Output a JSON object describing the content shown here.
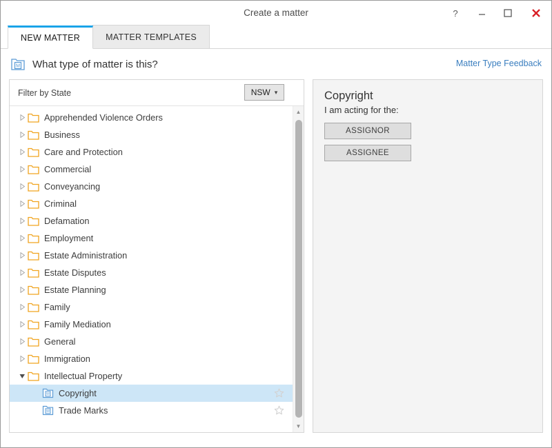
{
  "window": {
    "title": "Create a matter",
    "controls": [
      {
        "name": "help-button",
        "glyph": "?"
      },
      {
        "name": "minimize-button",
        "glyph": "–"
      },
      {
        "name": "maximize-button",
        "glyph": "□"
      },
      {
        "name": "close-button",
        "glyph": "✕"
      }
    ]
  },
  "tabs": [
    {
      "label": "NEW MATTER",
      "active": true
    },
    {
      "label": "MATTER TEMPLATES",
      "active": false
    }
  ],
  "header": {
    "icon": "matter-document-icon",
    "question": "What type of matter is this?",
    "feedback_link": "Matter Type Feedback"
  },
  "filter": {
    "label": "Filter by State",
    "state_value": "NSW",
    "chevron": "ˇ"
  },
  "tree": {
    "items": [
      {
        "label": "Apprehended Violence Orders",
        "level": 0,
        "state": "collapsed",
        "icon": "folder-icon",
        "selected": false,
        "star": false
      },
      {
        "label": "Business",
        "level": 0,
        "state": "collapsed",
        "icon": "folder-icon",
        "selected": false,
        "star": false
      },
      {
        "label": "Care and Protection",
        "level": 0,
        "state": "collapsed",
        "icon": "folder-icon",
        "selected": false,
        "star": false
      },
      {
        "label": "Commercial",
        "level": 0,
        "state": "collapsed",
        "icon": "folder-icon",
        "selected": false,
        "star": false
      },
      {
        "label": "Conveyancing",
        "level": 0,
        "state": "collapsed",
        "icon": "folder-icon",
        "selected": false,
        "star": false
      },
      {
        "label": "Criminal",
        "level": 0,
        "state": "collapsed",
        "icon": "folder-icon",
        "selected": false,
        "star": false
      },
      {
        "label": "Defamation",
        "level": 0,
        "state": "collapsed",
        "icon": "folder-icon",
        "selected": false,
        "star": false
      },
      {
        "label": "Employment",
        "level": 0,
        "state": "collapsed",
        "icon": "folder-icon",
        "selected": false,
        "star": false
      },
      {
        "label": "Estate Administration",
        "level": 0,
        "state": "collapsed",
        "icon": "folder-icon",
        "selected": false,
        "star": false
      },
      {
        "label": "Estate Disputes",
        "level": 0,
        "state": "collapsed",
        "icon": "folder-icon",
        "selected": false,
        "star": false
      },
      {
        "label": "Estate Planning",
        "level": 0,
        "state": "collapsed",
        "icon": "folder-icon",
        "selected": false,
        "star": false
      },
      {
        "label": "Family",
        "level": 0,
        "state": "collapsed",
        "icon": "folder-icon",
        "selected": false,
        "star": false
      },
      {
        "label": "Family Mediation",
        "level": 0,
        "state": "collapsed",
        "icon": "folder-icon",
        "selected": false,
        "star": false
      },
      {
        "label": "General",
        "level": 0,
        "state": "collapsed",
        "icon": "folder-icon",
        "selected": false,
        "star": false
      },
      {
        "label": "Immigration",
        "level": 0,
        "state": "collapsed",
        "icon": "folder-icon",
        "selected": false,
        "star": false
      },
      {
        "label": "Intellectual Property",
        "level": 0,
        "state": "expanded",
        "icon": "folder-icon",
        "selected": false,
        "star": false
      },
      {
        "label": "Copyright",
        "level": 1,
        "state": "leaf",
        "icon": "matter-document-icon",
        "selected": true,
        "star": true
      },
      {
        "label": "Trade Marks",
        "level": 1,
        "state": "leaf",
        "icon": "matter-document-icon",
        "selected": false,
        "star": true
      }
    ]
  },
  "detail": {
    "title": "Copyright",
    "subtitle": "I am acting for the:",
    "buttons": [
      {
        "label": "ASSIGNOR",
        "name": "assignor-button"
      },
      {
        "label": "ASSIGNEE",
        "name": "assignee-button"
      }
    ]
  },
  "colors": {
    "accent_tab": "#1aa3e8",
    "link": "#3a7ebf",
    "selection": "#cde6f7",
    "folder": "#f0a31e",
    "close": "#d81f26"
  }
}
